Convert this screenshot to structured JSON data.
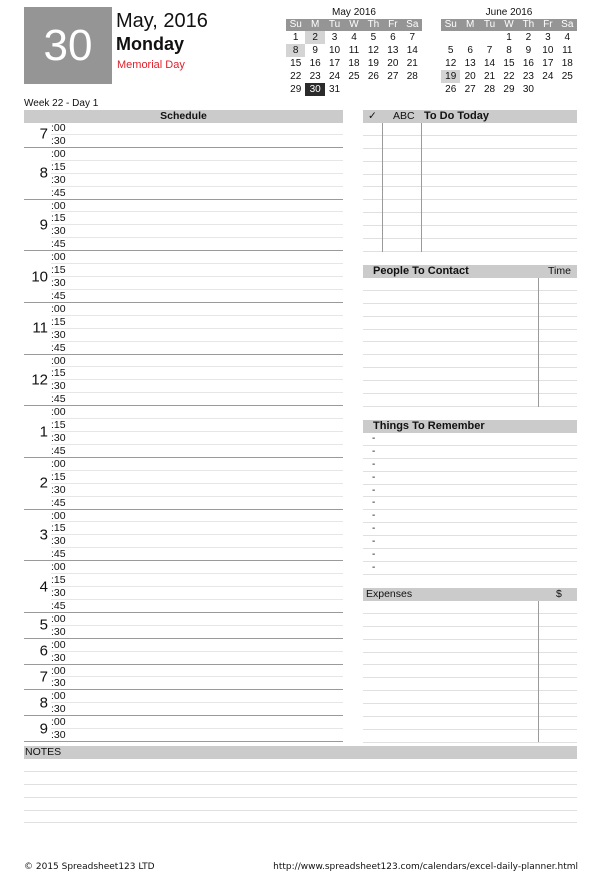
{
  "header": {
    "day_number": "30",
    "month_year": "May, 2016",
    "weekday": "Monday",
    "holiday": "Memorial Day",
    "week_label": "Week 22 - Day 1"
  },
  "mini_calendars": [
    {
      "title": "May 2016",
      "dow": [
        "Su",
        "M",
        "Tu",
        "W",
        "Th",
        "Fr",
        "Sa"
      ],
      "leading_blanks": 0,
      "days": 31,
      "highlighted": [
        2,
        8
      ],
      "selected": 30
    },
    {
      "title": "June 2016",
      "dow": [
        "Su",
        "M",
        "Tu",
        "W",
        "Th",
        "Fr",
        "Sa"
      ],
      "leading_blanks": 3,
      "days": 30,
      "highlighted": [
        19
      ],
      "selected": null
    }
  ],
  "schedule": {
    "title": "Schedule",
    "hours": [
      {
        "hour": "7",
        "slots": [
          ":00",
          ":30"
        ]
      },
      {
        "hour": "8",
        "slots": [
          ":00",
          ":15",
          ":30",
          ":45"
        ]
      },
      {
        "hour": "9",
        "slots": [
          ":00",
          ":15",
          ":30",
          ":45"
        ]
      },
      {
        "hour": "10",
        "slots": [
          ":00",
          ":15",
          ":30",
          ":45"
        ]
      },
      {
        "hour": "11",
        "slots": [
          ":00",
          ":15",
          ":30",
          ":45"
        ]
      },
      {
        "hour": "12",
        "slots": [
          ":00",
          ":15",
          ":30",
          ":45"
        ]
      },
      {
        "hour": "1",
        "slots": [
          ":00",
          ":15",
          ":30",
          ":45"
        ]
      },
      {
        "hour": "2",
        "slots": [
          ":00",
          ":15",
          ":30",
          ":45"
        ]
      },
      {
        "hour": "3",
        "slots": [
          ":00",
          ":15",
          ":30",
          ":45"
        ]
      },
      {
        "hour": "4",
        "slots": [
          ":00",
          ":15",
          ":30",
          ":45"
        ]
      },
      {
        "hour": "5",
        "slots": [
          ":00",
          ":30"
        ]
      },
      {
        "hour": "6",
        "slots": [
          ":00",
          ":30"
        ]
      },
      {
        "hour": "7",
        "slots": [
          ":00",
          ":30"
        ]
      },
      {
        "hour": "8",
        "slots": [
          ":00",
          ":30"
        ]
      },
      {
        "hour": "9",
        "slots": [
          ":00",
          ":30"
        ]
      }
    ]
  },
  "todo": {
    "check_label": "✓",
    "priority_label": "ABC",
    "title": "To Do Today",
    "rows": 10
  },
  "contacts": {
    "title": "People To Contact",
    "time_label": "Time",
    "rows": 10
  },
  "remember": {
    "title": "Things To Remember",
    "items": [
      "-",
      "-",
      "-",
      "-",
      "-",
      "-",
      "-",
      "-",
      "-",
      "-",
      "-"
    ]
  },
  "expenses": {
    "title": "Expenses",
    "amount_label": "$",
    "rows": 11
  },
  "notes": {
    "title": "NOTES",
    "rows": 5
  },
  "footer": {
    "copyright": "© 2015 Spreadsheet123 LTD",
    "url": "http://www.spreadsheet123.com/calendars/excel-daily-planner.html"
  }
}
